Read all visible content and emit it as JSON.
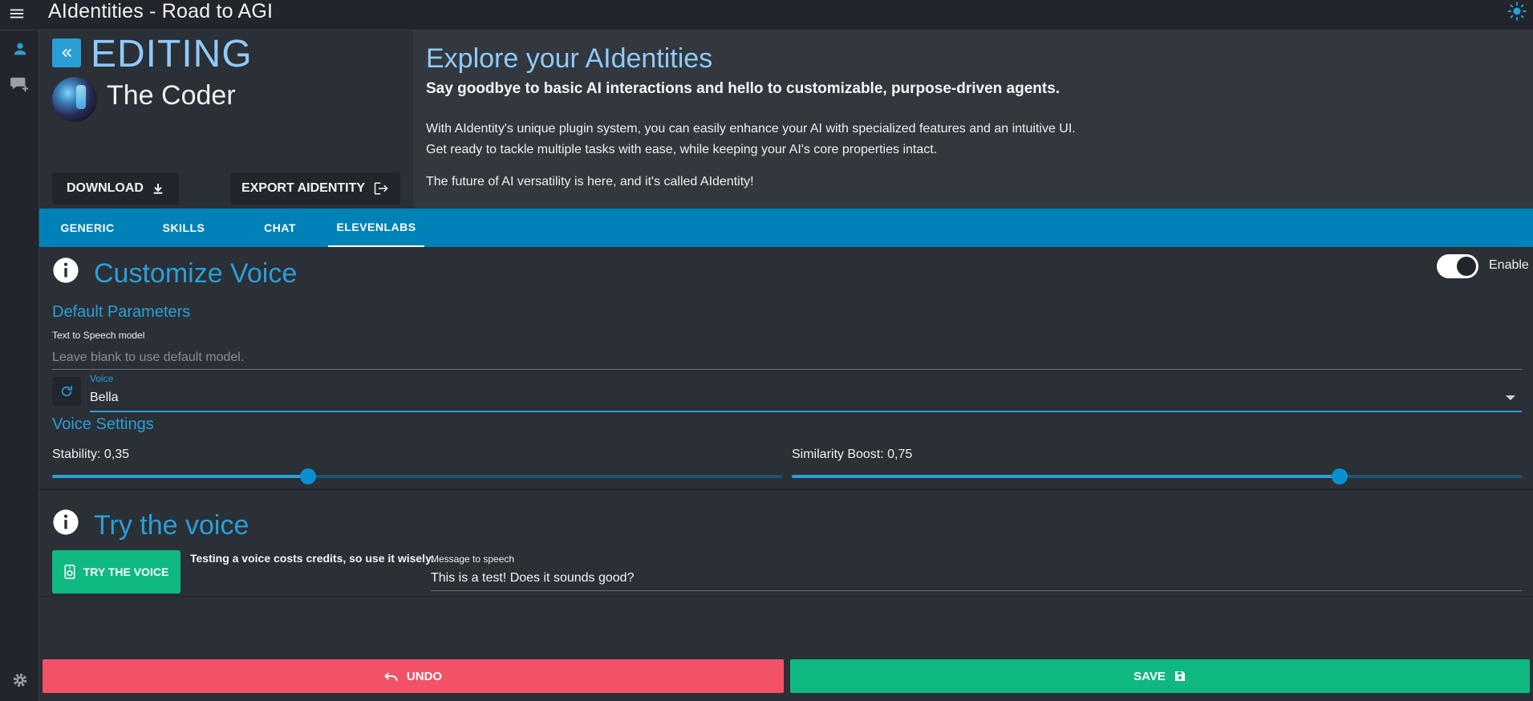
{
  "app": {
    "title": "AIdentities - Road to AGI"
  },
  "icons": {
    "menu": "hamburger-menu-icon",
    "theme": "sun-theme-icon",
    "rail_profile": "person-icon",
    "rail_chat_add": "chat-add-icon",
    "rail_settings": "gear-icon",
    "back": "chevrons-left-icon",
    "download": "download-icon",
    "export": "export-icon",
    "info": "info-icon",
    "refresh": "refresh-icon",
    "speaker": "speaker-icon",
    "undo": "undo-icon",
    "save": "floppy-disk-icon"
  },
  "colors": {
    "accent": "#2a9fd6",
    "tabbar": "#0082b8",
    "success": "#10b981",
    "danger": "#f25267",
    "title_light": "#90caf9"
  },
  "header": {
    "mode": "EDITING",
    "agent_name": "The Coder",
    "download_label": "DOWNLOAD",
    "export_label": "EXPORT AIDENTITY"
  },
  "intro": {
    "title": "Explore your AIdentities",
    "subtitle": "Say goodbye to basic AI interactions and hello to customizable, purpose-driven agents.",
    "line1": "With AIdentity's unique plugin system, you can easily enhance your AI with specialized features and an intuitive UI.",
    "line2": "Get ready to tackle multiple tasks with ease, while keeping your AI's core properties intact.",
    "line3": "The future of AI versatility is here, and it's called AIdentity!"
  },
  "tabs": [
    {
      "label": "GENERIC"
    },
    {
      "label": "SKILLS"
    },
    {
      "label": "CHAT"
    },
    {
      "label": "ELEVENLABS"
    }
  ],
  "active_tab": "ELEVENLABS",
  "customize": {
    "title": "Customize Voice",
    "enable_label": "Enable",
    "enabled": true,
    "default_params_heading": "Default Parameters",
    "tts_model_label": "Text to Speech model",
    "tts_model_value": "",
    "tts_model_placeholder": "Leave blank to use default model.",
    "voice_label": "Voice",
    "voice_value": "Bella",
    "voice_settings_heading": "Voice Settings",
    "stability_label": "Stability: 0,35",
    "stability": 0.35,
    "similarity_label": "Similarity Boost: 0,75",
    "similarity": 0.75
  },
  "try_voice": {
    "title": "Try the voice",
    "button_label": "TRY THE VOICE",
    "cost_note": "Testing a voice costs credits, so use it wisely.",
    "message_label": "Message to speech",
    "message_value": "This is a test! Does it sounds good?"
  },
  "footer": {
    "undo_label": "UNDO",
    "save_label": "SAVE"
  }
}
